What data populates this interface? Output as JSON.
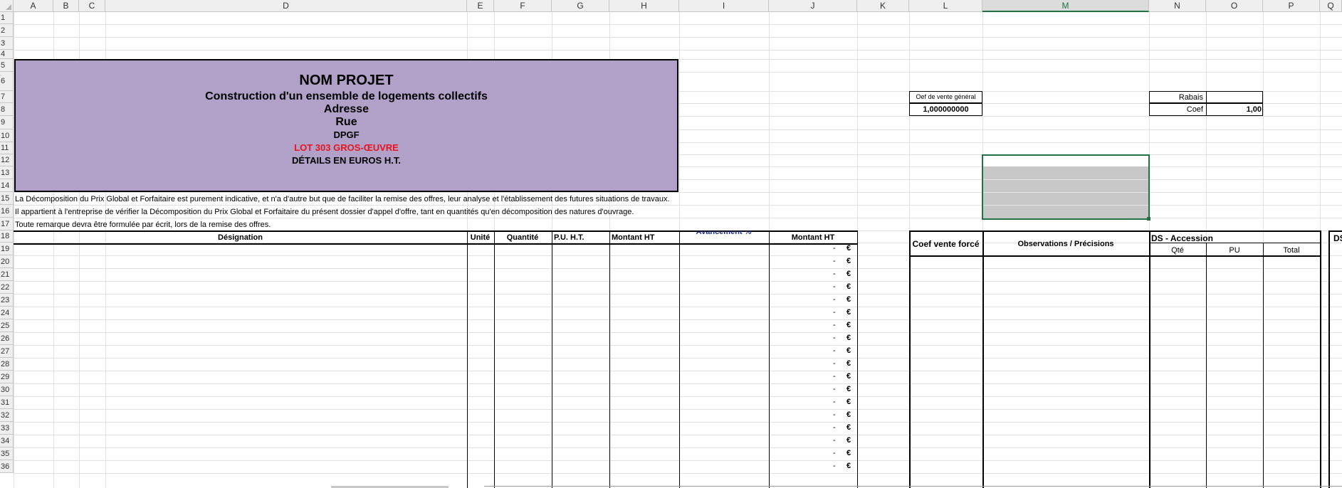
{
  "columns": [
    "A",
    "B",
    "C",
    "D",
    "E",
    "F",
    "G",
    "H",
    "I",
    "J",
    "K",
    "L",
    "M",
    "N",
    "O",
    "P",
    "Q"
  ],
  "rows": [
    "1",
    "2",
    "3",
    "4",
    "5",
    "6",
    "7",
    "8",
    "9",
    "10",
    "11",
    "12",
    "13",
    "14",
    "15",
    "16",
    "17",
    "18",
    "19",
    "20",
    "21",
    "22",
    "23",
    "24",
    "25",
    "26",
    "27",
    "28",
    "29",
    "30",
    "31",
    "32",
    "33",
    "34",
    "35",
    "36"
  ],
  "header": {
    "title": "NOM PROJET",
    "subtitle": "Construction d'un ensemble de logements collectifs",
    "address": "Adresse",
    "street": "Rue",
    "doc_type": "DPGF",
    "lot": "LOT 303 GROS-ŒUVRE",
    "details": "DÉTAILS EN EUROS H.T."
  },
  "notes": [
    "La Décomposition du Prix Global et Forfaitaire est purement indicative, et n'a d'autre but que de faciliter la remise des offres, leur analyse et l'établissement des futures situations de travaux.",
    "Il appartient à l'entreprise de vérifier la Décomposition du Prix Global et Forfaitaire du présent dossier d'appel d'offre, tant en quantités qu'en décomposition des natures d'ouvrage.",
    "Toute remarque devra être formulée par écrit, lors de la remise des offres."
  ],
  "coef_vente": {
    "label": "Oef de vente général",
    "value": "1,000000000"
  },
  "rabais": {
    "rabais_label": "Rabais",
    "coef_label": "Coef",
    "coef_value": "1,00"
  },
  "table_headers": {
    "designation": "Désignation",
    "unite": "Unité",
    "quantite": "Quantité",
    "pu_ht": "P.U. H.T.",
    "montant_ht": "Montant HT",
    "avancement": "Avancement %",
    "montant_ht_2": "Montant HT"
  },
  "right_headers": {
    "coef_force": "Coef vente forcé",
    "observations": "Observations / Précisions",
    "ds_accession": "DS - Accession",
    "qte": "Qté",
    "pu": "PU",
    "total": "Total",
    "ds_cut": "DS"
  },
  "amount_rows": {
    "dash": "-",
    "currency": "€",
    "count": 18
  },
  "colors": {
    "header_fill": "#b1a0c7",
    "lot_red": "#e8141f",
    "selection": "#217346"
  }
}
